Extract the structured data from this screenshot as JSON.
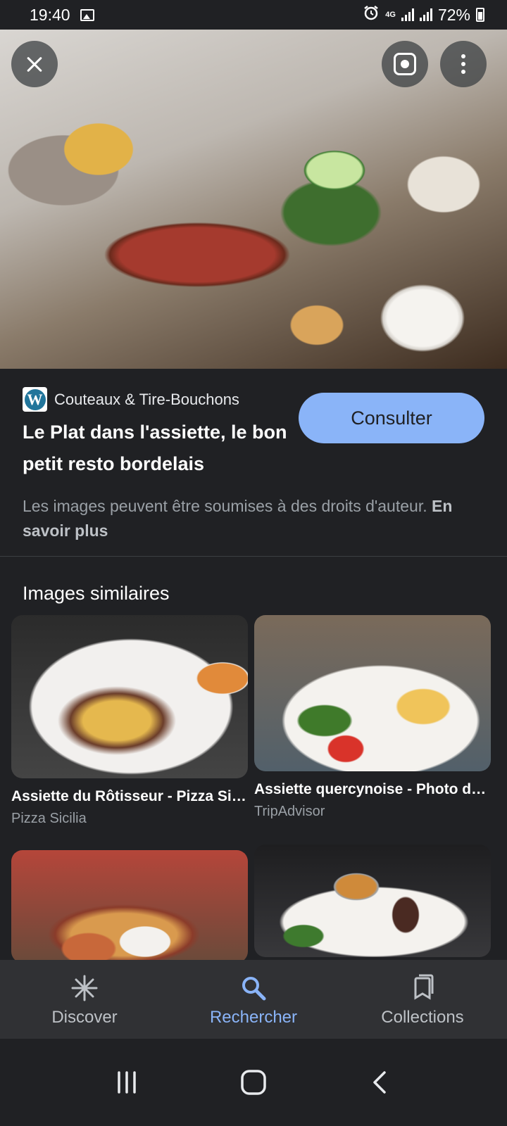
{
  "status_bar": {
    "time": "19:40",
    "network": "4G",
    "battery": "72%"
  },
  "hero": {
    "close_icon": "close-icon",
    "lens_icon": "lens-icon",
    "more_icon": "more-vert-icon"
  },
  "result": {
    "source_name": "Couteaux & Tire-Bouchons",
    "source_icon": "wordpress-icon",
    "title": "Le Plat dans l'assiette, le bon petit resto bordelais",
    "visit_button": "Consulter",
    "rights_text": "Les images peuvent être soumises à des droits d'auteur.",
    "rights_link": "En savoir plus"
  },
  "similar": {
    "heading": "Images similaires",
    "items": [
      {
        "title": "Assiette du Rôtisseur - Pizza Sicilia",
        "source": "Pizza Sicilia"
      },
      {
        "title": "Assiette quercynoise - Photo de ...",
        "source": "TripAdvisor"
      },
      {
        "title": "",
        "source": ""
      },
      {
        "title": "",
        "source": ""
      }
    ]
  },
  "bottom_nav": {
    "items": [
      {
        "label": "Discover",
        "icon": "asterisk-icon"
      },
      {
        "label": "Rechercher",
        "icon": "search-icon",
        "active": true
      },
      {
        "label": "Collections",
        "icon": "collections-icon"
      }
    ]
  },
  "colors": {
    "background": "#202124",
    "accent": "#8ab4f8",
    "nav_background": "#303134"
  }
}
